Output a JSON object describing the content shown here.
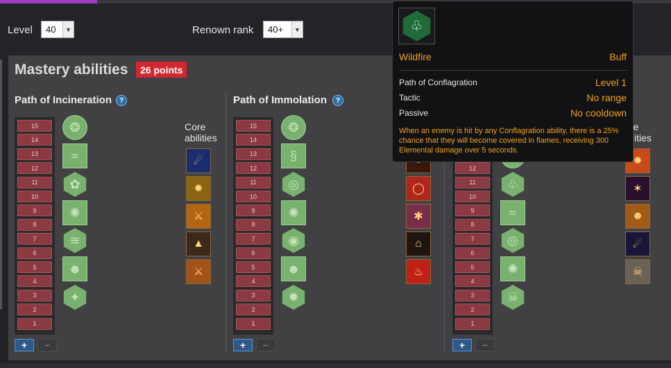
{
  "controls": {
    "level_label": "Level",
    "level_value": "40",
    "renown_label": "Renown rank",
    "renown_value": "40+"
  },
  "panel": {
    "title": "Mastery abilities",
    "points": "26 points"
  },
  "paths": [
    {
      "title": "Path of Incineration",
      "help": "?",
      "core_label_line1": "Core",
      "core_label_line2": "abilities"
    },
    {
      "title": "Path of Immolation",
      "help": "?",
      "core_label_line1": "Core",
      "core_label_line2": "abilities"
    },
    {
      "title": "Path of Conflagration",
      "core_label_line1": "ore",
      "core_label_line2": "bilities"
    }
  ],
  "ranks": [
    "15",
    "14",
    "13",
    "12",
    "11",
    "10",
    "9",
    "8",
    "7",
    "6",
    "5",
    "4",
    "3",
    "2",
    "1"
  ],
  "buttons": {
    "plus": "+",
    "minus": "−"
  },
  "tooltip": {
    "name": "Wildfire",
    "type": "Buff",
    "path_label": "Path of Conflagration",
    "path_value": "Level 1",
    "tactic_label": "Tactic",
    "tactic_value": "No range",
    "passive_label": "Passive",
    "passive_value": "No cooldown",
    "description": "When an enemy is hit by any Conflagration ability, there is a 25% chance that they will become covered in flames, receiving 300 Elemental damage over 5 seconds."
  },
  "colors": {
    "accent": "#9b3fc4",
    "points_badge": "#d2272e",
    "tooltip_highlight": "#f0a21c",
    "rank_cell": "#8b3a42",
    "ability_green": "#79b26e"
  }
}
